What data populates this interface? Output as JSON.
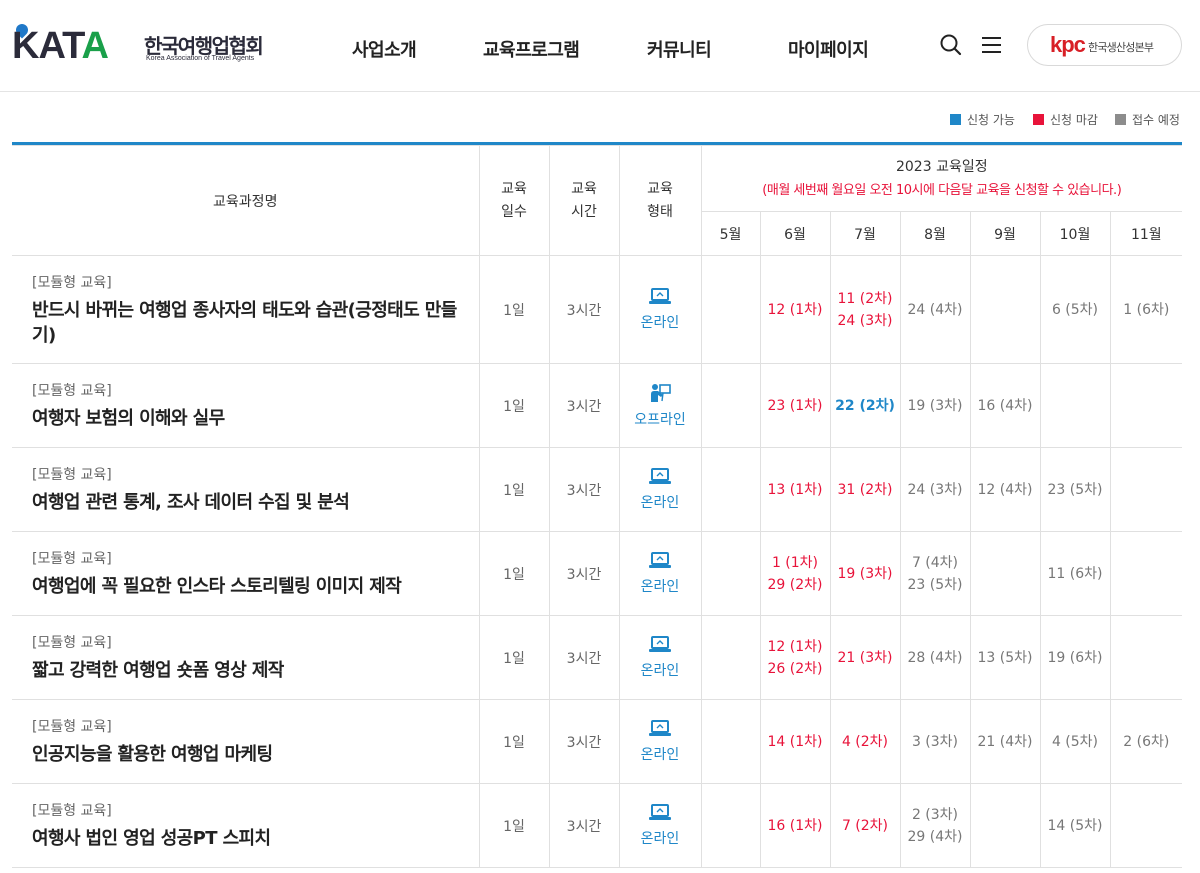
{
  "header": {
    "logo_mark": "KATA",
    "logo_ko": "한국여행업협회",
    "logo_en": "Korea Association of Travel Agents",
    "nav": [
      "사업소개",
      "교육프로그램",
      "커뮤니티",
      "마이페이지"
    ],
    "search_icon": "search-icon",
    "menu_icon": "hamburger-menu-icon",
    "partner_logo": "kpc",
    "partner_text": "한국생산성본부"
  },
  "legend": [
    {
      "label": "신청 가능",
      "color": "#1f87c8"
    },
    {
      "label": "신청 마감",
      "color": "#e8133a"
    },
    {
      "label": "접수 예정",
      "color": "#8c8c8c"
    }
  ],
  "table": {
    "headers": {
      "course": "교육과정명",
      "days": [
        "교육",
        "일수"
      ],
      "hours": [
        "교육",
        "시간"
      ],
      "type": [
        "교육",
        "형태"
      ],
      "schedule_title": "2023 교육일정",
      "schedule_note": "(매월 세번째 월요일 오전 10시에 다음달 교육을 신청할 수 있습니다.)",
      "months": [
        "5월",
        "6월",
        "7월",
        "8월",
        "9월",
        "10월",
        "11월"
      ]
    },
    "rows": [
      {
        "category": "[모듈형 교육]",
        "title": "반드시 바뀌는 여행업 종사자의 태도와 습관(긍정태도 만들기)",
        "days": "1일",
        "hours": "3시간",
        "type": "온라인",
        "type_icon": "laptop-icon",
        "months": [
          [],
          [
            {
              "t": "12 (1차)",
              "s": "closed"
            }
          ],
          [
            {
              "t": "11 (2차)",
              "s": "closed"
            },
            {
              "t": "24 (3차)",
              "s": "closed"
            }
          ],
          [
            {
              "t": "24 (4차)",
              "s": "planned"
            }
          ],
          [],
          [
            {
              "t": "6 (5차)",
              "s": "planned"
            }
          ],
          [
            {
              "t": "1 (6차)",
              "s": "planned"
            }
          ]
        ]
      },
      {
        "category": "[모듈형 교육]",
        "title": "여행자 보험의 이해와 실무",
        "days": "1일",
        "hours": "3시간",
        "type": "오프라인",
        "type_icon": "presenter-icon",
        "months": [
          [],
          [
            {
              "t": "23 (1차)",
              "s": "closed"
            }
          ],
          [
            {
              "t": "22 (2차)",
              "s": "avail"
            }
          ],
          [
            {
              "t": "19 (3차)",
              "s": "planned"
            }
          ],
          [
            {
              "t": "16 (4차)",
              "s": "planned"
            }
          ],
          [],
          []
        ]
      },
      {
        "category": "[모듈형 교육]",
        "title": "여행업 관련 통계, 조사 데이터 수집 및 분석",
        "days": "1일",
        "hours": "3시간",
        "type": "온라인",
        "type_icon": "laptop-icon",
        "months": [
          [],
          [
            {
              "t": "13 (1차)",
              "s": "closed"
            }
          ],
          [
            {
              "t": "31 (2차)",
              "s": "closed"
            }
          ],
          [
            {
              "t": "24 (3차)",
              "s": "planned"
            }
          ],
          [
            {
              "t": "12 (4차)",
              "s": "planned"
            }
          ],
          [
            {
              "t": "23 (5차)",
              "s": "planned"
            }
          ],
          []
        ]
      },
      {
        "category": "[모듈형 교육]",
        "title": "여행업에 꼭 필요한 인스타 스토리텔링 이미지 제작",
        "days": "1일",
        "hours": "3시간",
        "type": "온라인",
        "type_icon": "laptop-icon",
        "months": [
          [],
          [
            {
              "t": "1 (1차)",
              "s": "closed"
            },
            {
              "t": "29 (2차)",
              "s": "closed"
            }
          ],
          [
            {
              "t": "19 (3차)",
              "s": "closed"
            }
          ],
          [
            {
              "t": "7 (4차)",
              "s": "planned"
            },
            {
              "t": "23 (5차)",
              "s": "planned"
            }
          ],
          [],
          [
            {
              "t": "11 (6차)",
              "s": "planned"
            }
          ],
          []
        ]
      },
      {
        "category": "[모듈형 교육]",
        "title": "짧고 강력한 여행업 숏폼 영상 제작",
        "days": "1일",
        "hours": "3시간",
        "type": "온라인",
        "type_icon": "laptop-icon",
        "months": [
          [],
          [
            {
              "t": "12 (1차)",
              "s": "closed"
            },
            {
              "t": "26 (2차)",
              "s": "closed"
            }
          ],
          [
            {
              "t": "21 (3차)",
              "s": "closed"
            }
          ],
          [
            {
              "t": "28 (4차)",
              "s": "planned"
            }
          ],
          [
            {
              "t": "13 (5차)",
              "s": "planned"
            }
          ],
          [
            {
              "t": "19 (6차)",
              "s": "planned"
            }
          ],
          []
        ]
      },
      {
        "category": "[모듈형 교육]",
        "title": "인공지능을 활용한 여행업 마케팅",
        "days": "1일",
        "hours": "3시간",
        "type": "온라인",
        "type_icon": "laptop-icon",
        "months": [
          [],
          [
            {
              "t": "14 (1차)",
              "s": "closed"
            }
          ],
          [
            {
              "t": "4 (2차)",
              "s": "closed"
            }
          ],
          [
            {
              "t": "3 (3차)",
              "s": "planned"
            }
          ],
          [
            {
              "t": "21 (4차)",
              "s": "planned"
            }
          ],
          [
            {
              "t": "4 (5차)",
              "s": "planned"
            }
          ],
          [
            {
              "t": "2 (6차)",
              "s": "planned"
            }
          ]
        ]
      },
      {
        "category": "[모듈형 교육]",
        "title": "여행사 법인 영업 성공PT 스피치",
        "days": "1일",
        "hours": "3시간",
        "type": "온라인",
        "type_icon": "laptop-icon",
        "months": [
          [],
          [
            {
              "t": "16 (1차)",
              "s": "closed"
            }
          ],
          [
            {
              "t": "7 (2차)",
              "s": "closed"
            }
          ],
          [
            {
              "t": "2 (3차)",
              "s": "planned"
            },
            {
              "t": "29 (4차)",
              "s": "planned"
            }
          ],
          [],
          [
            {
              "t": "14 (5차)",
              "s": "planned"
            }
          ],
          []
        ]
      }
    ]
  }
}
